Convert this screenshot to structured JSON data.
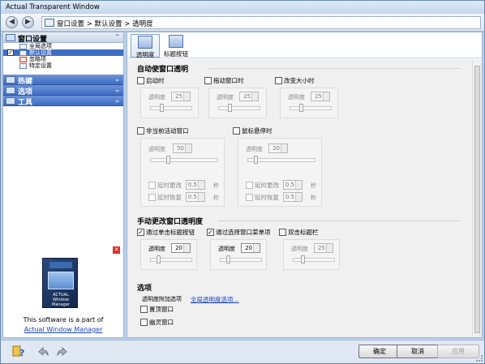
{
  "window": {
    "title": "Actual Transparent Window"
  },
  "address": {
    "crumb1": "窗口设置",
    "crumb2": "默认设置",
    "crumb3": "透明度",
    "sep": ">"
  },
  "sidebar": {
    "group1": {
      "label": "窗口设置",
      "items": [
        {
          "label": "全局选项",
          "checked": false
        },
        {
          "label": "默认设置",
          "checked": true,
          "selected": true
        },
        {
          "label": "忽略项",
          "checked": false
        },
        {
          "label": "特定设置",
          "checked": false
        }
      ]
    },
    "group2": {
      "label": "热键"
    },
    "group3": {
      "label": "选项"
    },
    "group4": {
      "label": "工具"
    },
    "promo": {
      "product_name": "Window Manager",
      "brand": "ACTUAL",
      "line1": "This software is a part of",
      "link": "Actual Window Manager"
    }
  },
  "tabs": [
    {
      "label": "透明度",
      "active": true
    },
    {
      "label": "标题按钮",
      "active": false
    }
  ],
  "auto": {
    "title": "自动使窗口透明",
    "opacity_label": "透明度",
    "startup": {
      "label": "启动时",
      "checked": false,
      "value": "25"
    },
    "drag": {
      "label": "拖动窗口时",
      "checked": false,
      "value": "25"
    },
    "resize": {
      "label": "改变大小时",
      "checked": false,
      "value": "25"
    },
    "inactive": {
      "label": "非当前活动窗口",
      "checked": false,
      "value": "50",
      "delay_change": "延时更改",
      "delay_change_value": "0.5",
      "delay_restore": "延时恢复",
      "delay_restore_value": "0.5",
      "unit": "秒"
    },
    "hover": {
      "label": "鼠标悬停时",
      "checked": false,
      "value": "20",
      "delay_change": "延时更改",
      "delay_change_value": "0.5",
      "delay_restore": "延时恢复",
      "delay_restore_value": "0.5",
      "unit": "秒"
    }
  },
  "manual": {
    "title": "手动更改窗口透明度",
    "opacity_label": "透明度",
    "title_button": {
      "label": "通过单击标题按钮",
      "checked": true,
      "value": "20"
    },
    "menu": {
      "label": "通过选择窗口菜单项",
      "checked": true,
      "value": "20"
    },
    "dblclick": {
      "label": "双击标题栏",
      "checked": false,
      "value": "25"
    }
  },
  "options": {
    "title": "选项",
    "extra_label": "透明度附加选项",
    "extra_link": "全局透明度选项...",
    "topmost": {
      "label": "置顶窗口",
      "checked": false
    },
    "ghost": {
      "label": "幽灵窗口",
      "checked": false
    }
  },
  "buttons": {
    "ok": "确定",
    "cancel": "取消",
    "apply": "应用"
  }
}
